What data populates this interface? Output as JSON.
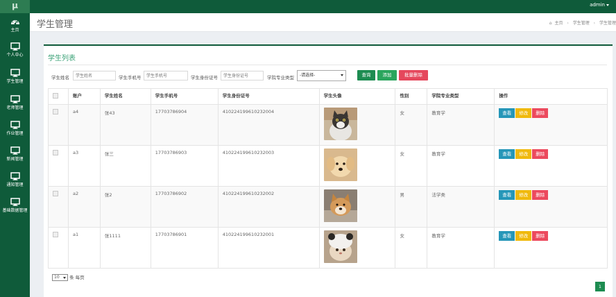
{
  "brand": {
    "logo": "μ"
  },
  "topbar": {
    "user": "admin"
  },
  "sidebar": {
    "items": [
      {
        "label": "主页",
        "icon": "dashboard-icon"
      },
      {
        "label": "个人中心",
        "icon": "monitor-icon"
      },
      {
        "label": "学生管理",
        "icon": "monitor-icon"
      },
      {
        "label": "老师管理",
        "icon": "monitor-icon"
      },
      {
        "label": "作业管理",
        "icon": "monitor-icon"
      },
      {
        "label": "新闻管理",
        "icon": "monitor-icon"
      },
      {
        "label": "通知管理",
        "icon": "monitor-icon"
      },
      {
        "label": "基础数据管理",
        "icon": "monitor-icon"
      }
    ]
  },
  "header": {
    "title": "学生管理",
    "breadcrumb": [
      "主页",
      "学生管理",
      "学生管理"
    ]
  },
  "panel": {
    "title": "学生列表"
  },
  "search": {
    "name_label": "学生姓名",
    "name_placeholder": "学生姓名",
    "phone_label": "学生手机号",
    "phone_placeholder": "学生手机号",
    "id_label": "学生身份证号",
    "id_placeholder": "学生身份证号",
    "major_label": "学院专业类型",
    "major_selected": "-请选择-",
    "query_button": "查询",
    "add_button": "添加",
    "batch_delete_button": "批量删除"
  },
  "table": {
    "headers": [
      "账户",
      "学生姓名",
      "学生手机号",
      "学生身份证号",
      "学生头像",
      "性别",
      "学院专业类型",
      "操作"
    ],
    "rows": [
      {
        "account": "a4",
        "name": "张43",
        "phone": "17703786904",
        "id_card": "410224199610232004",
        "gender": "女",
        "major": "教育学",
        "avatar": "cat"
      },
      {
        "account": "a3",
        "name": "张三",
        "phone": "17703786903",
        "id_card": "410224199610232003",
        "gender": "女",
        "major": "教育学",
        "avatar": "puppy"
      },
      {
        "account": "a2",
        "name": "张2",
        "phone": "17703786902",
        "id_card": "410224199610232002",
        "gender": "男",
        "major": "法学类",
        "avatar": "shiba"
      },
      {
        "account": "a1",
        "name": "张1111",
        "phone": "17703786901",
        "id_card": "410224199610232001",
        "gender": "女",
        "major": "教育学",
        "avatar": "cat-hat"
      }
    ],
    "actions": {
      "view": "查看",
      "edit": "修改",
      "delete": "删除"
    }
  },
  "pagination": {
    "page_size": "10",
    "per_page_label": "条 每页",
    "current_page": "1"
  },
  "colors": {
    "sidebar": "#0f5b3a",
    "accent": "#1d8c51",
    "danger": "#e5475c",
    "info": "#2596b8",
    "warning": "#f0b90c"
  }
}
